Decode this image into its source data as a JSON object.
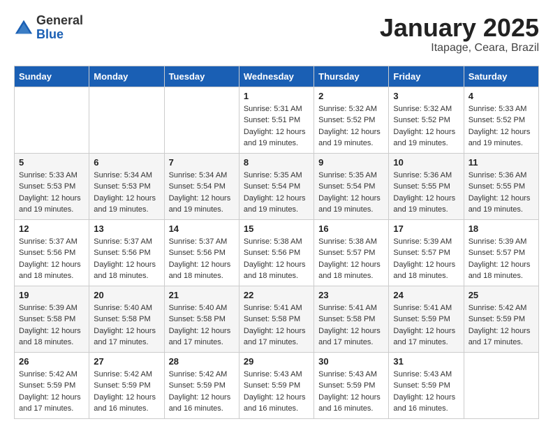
{
  "header": {
    "logo_general": "General",
    "logo_blue": "Blue",
    "month_title": "January 2025",
    "location": "Itapage, Ceara, Brazil"
  },
  "weekdays": [
    "Sunday",
    "Monday",
    "Tuesday",
    "Wednesday",
    "Thursday",
    "Friday",
    "Saturday"
  ],
  "weeks": [
    [
      {
        "day": "",
        "info": ""
      },
      {
        "day": "",
        "info": ""
      },
      {
        "day": "",
        "info": ""
      },
      {
        "day": "1",
        "info": "Sunrise: 5:31 AM\nSunset: 5:51 PM\nDaylight: 12 hours and 19 minutes."
      },
      {
        "day": "2",
        "info": "Sunrise: 5:32 AM\nSunset: 5:52 PM\nDaylight: 12 hours and 19 minutes."
      },
      {
        "day": "3",
        "info": "Sunrise: 5:32 AM\nSunset: 5:52 PM\nDaylight: 12 hours and 19 minutes."
      },
      {
        "day": "4",
        "info": "Sunrise: 5:33 AM\nSunset: 5:52 PM\nDaylight: 12 hours and 19 minutes."
      }
    ],
    [
      {
        "day": "5",
        "info": "Sunrise: 5:33 AM\nSunset: 5:53 PM\nDaylight: 12 hours and 19 minutes."
      },
      {
        "day": "6",
        "info": "Sunrise: 5:34 AM\nSunset: 5:53 PM\nDaylight: 12 hours and 19 minutes."
      },
      {
        "day": "7",
        "info": "Sunrise: 5:34 AM\nSunset: 5:54 PM\nDaylight: 12 hours and 19 minutes."
      },
      {
        "day": "8",
        "info": "Sunrise: 5:35 AM\nSunset: 5:54 PM\nDaylight: 12 hours and 19 minutes."
      },
      {
        "day": "9",
        "info": "Sunrise: 5:35 AM\nSunset: 5:54 PM\nDaylight: 12 hours and 19 minutes."
      },
      {
        "day": "10",
        "info": "Sunrise: 5:36 AM\nSunset: 5:55 PM\nDaylight: 12 hours and 19 minutes."
      },
      {
        "day": "11",
        "info": "Sunrise: 5:36 AM\nSunset: 5:55 PM\nDaylight: 12 hours and 19 minutes."
      }
    ],
    [
      {
        "day": "12",
        "info": "Sunrise: 5:37 AM\nSunset: 5:56 PM\nDaylight: 12 hours and 18 minutes."
      },
      {
        "day": "13",
        "info": "Sunrise: 5:37 AM\nSunset: 5:56 PM\nDaylight: 12 hours and 18 minutes."
      },
      {
        "day": "14",
        "info": "Sunrise: 5:37 AM\nSunset: 5:56 PM\nDaylight: 12 hours and 18 minutes."
      },
      {
        "day": "15",
        "info": "Sunrise: 5:38 AM\nSunset: 5:56 PM\nDaylight: 12 hours and 18 minutes."
      },
      {
        "day": "16",
        "info": "Sunrise: 5:38 AM\nSunset: 5:57 PM\nDaylight: 12 hours and 18 minutes."
      },
      {
        "day": "17",
        "info": "Sunrise: 5:39 AM\nSunset: 5:57 PM\nDaylight: 12 hours and 18 minutes."
      },
      {
        "day": "18",
        "info": "Sunrise: 5:39 AM\nSunset: 5:57 PM\nDaylight: 12 hours and 18 minutes."
      }
    ],
    [
      {
        "day": "19",
        "info": "Sunrise: 5:39 AM\nSunset: 5:58 PM\nDaylight: 12 hours and 18 minutes."
      },
      {
        "day": "20",
        "info": "Sunrise: 5:40 AM\nSunset: 5:58 PM\nDaylight: 12 hours and 17 minutes."
      },
      {
        "day": "21",
        "info": "Sunrise: 5:40 AM\nSunset: 5:58 PM\nDaylight: 12 hours and 17 minutes."
      },
      {
        "day": "22",
        "info": "Sunrise: 5:41 AM\nSunset: 5:58 PM\nDaylight: 12 hours and 17 minutes."
      },
      {
        "day": "23",
        "info": "Sunrise: 5:41 AM\nSunset: 5:58 PM\nDaylight: 12 hours and 17 minutes."
      },
      {
        "day": "24",
        "info": "Sunrise: 5:41 AM\nSunset: 5:59 PM\nDaylight: 12 hours and 17 minutes."
      },
      {
        "day": "25",
        "info": "Sunrise: 5:42 AM\nSunset: 5:59 PM\nDaylight: 12 hours and 17 minutes."
      }
    ],
    [
      {
        "day": "26",
        "info": "Sunrise: 5:42 AM\nSunset: 5:59 PM\nDaylight: 12 hours and 17 minutes."
      },
      {
        "day": "27",
        "info": "Sunrise: 5:42 AM\nSunset: 5:59 PM\nDaylight: 12 hours and 16 minutes."
      },
      {
        "day": "28",
        "info": "Sunrise: 5:42 AM\nSunset: 5:59 PM\nDaylight: 12 hours and 16 minutes."
      },
      {
        "day": "29",
        "info": "Sunrise: 5:43 AM\nSunset: 5:59 PM\nDaylight: 12 hours and 16 minutes."
      },
      {
        "day": "30",
        "info": "Sunrise: 5:43 AM\nSunset: 5:59 PM\nDaylight: 12 hours and 16 minutes."
      },
      {
        "day": "31",
        "info": "Sunrise: 5:43 AM\nSunset: 5:59 PM\nDaylight: 12 hours and 16 minutes."
      },
      {
        "day": "",
        "info": ""
      }
    ]
  ]
}
